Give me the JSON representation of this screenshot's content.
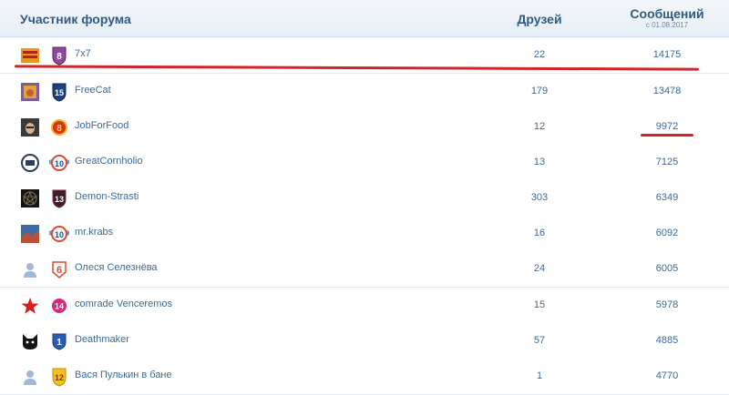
{
  "header": {
    "member": "Участник форума",
    "friends": "Друзей",
    "messages": "Сообщений",
    "messages_since": "с 01.08.2017"
  },
  "rows": [
    {
      "name": "7x7",
      "friends": "22",
      "messages": "14175",
      "rank": "8",
      "avatar_icon": "orange-banner-avatar-icon",
      "rank_icon": "purple-shield-rank-icon"
    },
    {
      "name": "FreeCat",
      "friends": "179",
      "messages": "13478",
      "rank": "15",
      "avatar_icon": "cat-picture-avatar-icon",
      "rank_icon": "blue-shield-rank-icon"
    },
    {
      "name": "JobForFood",
      "friends": "12",
      "messages": "9972",
      "rank": "8",
      "avatar_icon": "face-photo-avatar-icon",
      "rank_icon": "red-gold-badge-rank-icon"
    },
    {
      "name": "GreatCornholio",
      "friends": "13",
      "messages": "7125",
      "rank": "10",
      "avatar_icon": "round-emblem-avatar-icon",
      "rank_icon": "winged-badge-rank-icon"
    },
    {
      "name": "Demon-Strasti",
      "friends": "303",
      "messages": "6349",
      "rank": "13",
      "avatar_icon": "dark-pentagram-avatar-icon",
      "rank_icon": "dark-shield-rank-icon"
    },
    {
      "name": "mr.krabs",
      "friends": "16",
      "messages": "6092",
      "rank": "10",
      "avatar_icon": "landscape-avatar-icon",
      "rank_icon": "winged-badge-rank-icon"
    },
    {
      "name": "Олеся Селезнёва",
      "friends": "24",
      "messages": "6005",
      "rank": "6",
      "avatar_icon": "default-user-avatar-icon",
      "rank_icon": "red-outline-badge-rank-icon"
    },
    {
      "name": "comrade Venceremos",
      "friends": "15",
      "messages": "5978",
      "rank": "14",
      "avatar_icon": "red-star-avatar-icon",
      "rank_icon": "pink-circle-rank-icon"
    },
    {
      "name": "Deathmaker",
      "friends": "57",
      "messages": "4885",
      "rank": "1",
      "avatar_icon": "black-cat-avatar-icon",
      "rank_icon": "blue-small-shield-rank-icon"
    },
    {
      "name": "Вася Пулькин в бане",
      "friends": "1",
      "messages": "4770",
      "rank": "12",
      "avatar_icon": "default-user-avatar-icon",
      "rank_icon": "yellow-shield-rank-icon"
    }
  ],
  "colors": {
    "header_text": "#2f5a85",
    "row_text": "#3b6a97",
    "annotation_red": "#d3232a"
  }
}
